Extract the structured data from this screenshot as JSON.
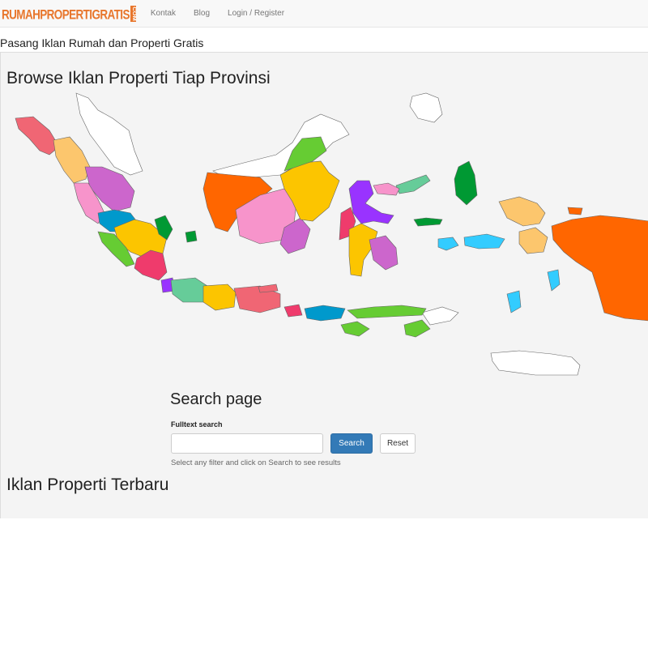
{
  "navbar": {
    "brand": "RUMAHPROPERTIGRATIS",
    "brand_badge": "COM",
    "links": [
      "Kontak",
      "Blog",
      "Login / Register"
    ]
  },
  "tagline": "Pasang Iklan Rumah dan Properti Gratis",
  "map_section": {
    "title": "Browse Iklan Properti Tiap Provinsi",
    "province_colors": [
      "#f06674",
      "#fcc66d",
      "#cc66cc",
      "#f794cb",
      "#0099cc",
      "#fcc500",
      "#66cc33",
      "#ef3b6c",
      "#009933",
      "#9933ff",
      "#66cc99",
      "#ff6600",
      "#33ccff",
      "#ffffff"
    ]
  },
  "search": {
    "title": "Search page",
    "fulltext_label": "Fulltext search",
    "input_value": "",
    "search_button": "Search",
    "reset_button": "Reset",
    "help": "Select any filter and click on Search to see results"
  },
  "latest": {
    "title": "Iklan Properti Terbaru"
  }
}
